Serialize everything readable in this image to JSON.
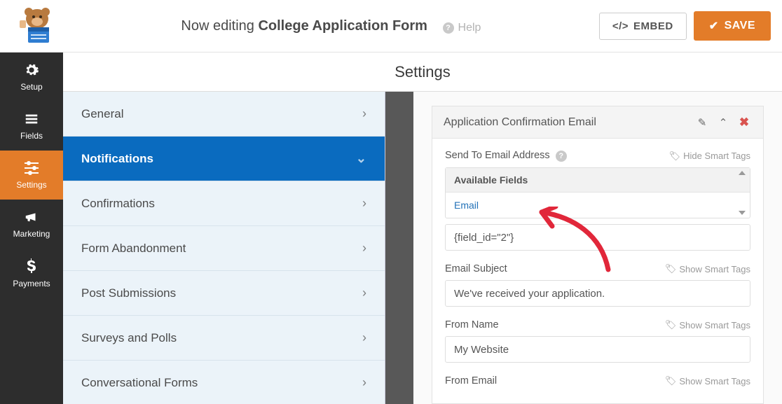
{
  "topbar": {
    "editing_prefix": "Now editing ",
    "form_name": "College Application Form",
    "help": "Help",
    "embed": "EMBED",
    "save": "SAVE"
  },
  "sidenav": [
    {
      "key": "setup",
      "label": "Setup"
    },
    {
      "key": "fields",
      "label": "Fields"
    },
    {
      "key": "settings",
      "label": "Settings",
      "active": true
    },
    {
      "key": "marketing",
      "label": "Marketing"
    },
    {
      "key": "payments",
      "label": "Payments"
    }
  ],
  "page_title": "Settings",
  "settings_menu": [
    {
      "label": "General"
    },
    {
      "label": "Notifications",
      "active": true
    },
    {
      "label": "Confirmations"
    },
    {
      "label": "Form Abandonment"
    },
    {
      "label": "Post Submissions"
    },
    {
      "label": "Surveys and Polls"
    },
    {
      "label": "Conversational Forms"
    }
  ],
  "panel": {
    "title": "Application Confirmation Email",
    "send_to_label": "Send To Email Address",
    "hide_tags": "Hide Smart Tags",
    "show_tags": "Show Smart Tags",
    "available_fields": "Available Fields",
    "available_item": "Email",
    "send_to_value": "{field_id=\"2\"}",
    "subject_label": "Email Subject",
    "subject_value": "We've received your application.",
    "from_name_label": "From Name",
    "from_name_value": "My Website",
    "from_email_label": "From Email"
  }
}
